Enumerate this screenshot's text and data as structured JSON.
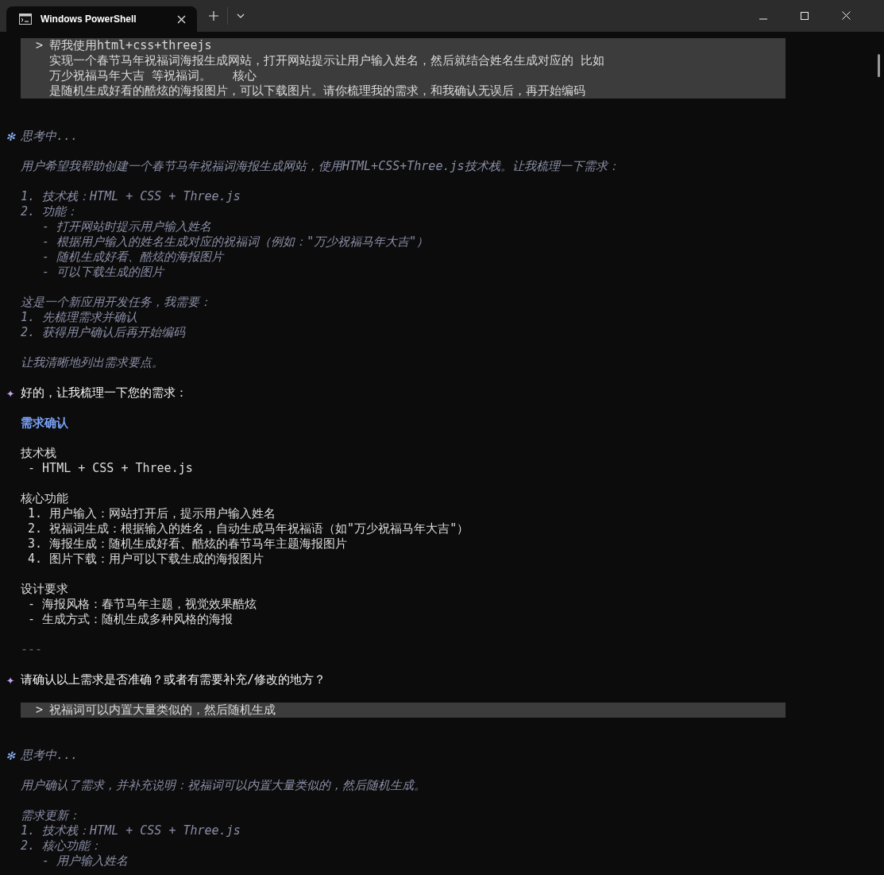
{
  "window": {
    "tab": {
      "title": "Windows PowerShell",
      "selected": true
    }
  },
  "messages": [
    {
      "kind": "prompt",
      "marker": ">",
      "lines": [
        "帮我使用html+css+threejs",
        "实现一个春节马年祝福词海报生成网站，打开网站提示让用户输入姓名，然后就结合姓名生成对应的 比如",
        "万少祝福马年大吉 等祝福词。   核心",
        "是随机生成好看的酷炫的海报图片，可以下载图片。请你梳理我的需求，和我确认无误后，再开始编码"
      ]
    },
    {
      "kind": "thinking",
      "marker": "✻",
      "title": "思考中...",
      "paragraphs": [
        [
          {
            "kind": "text",
            "text": "用户希望我帮助创建一个春节马年祝福词海报生成网站，使用HTML+CSS+Three.js技术栈。让我梳理一下需求："
          }
        ],
        [
          {
            "kind": "text",
            "text": "1. 技术栈：HTML + CSS + Three.js"
          },
          {
            "kind": "text",
            "text": "2. 功能："
          },
          {
            "kind": "text",
            "text": "   - 打开网站时提示用户输入姓名"
          },
          {
            "kind": "text",
            "text": "   - 根据用户输入的姓名生成对应的祝福词（例如：\"万少祝福马年大吉\"）"
          },
          {
            "kind": "text",
            "text": "   - 随机生成好看、酷炫的海报图片"
          },
          {
            "kind": "text",
            "text": "   - 可以下载生成的图片"
          }
        ],
        [
          {
            "kind": "text",
            "text": "这是一个新应用开发任务，我需要："
          },
          {
            "kind": "text",
            "text": "1. 先梳理需求并确认"
          },
          {
            "kind": "text",
            "text": "2. 获得用户确认后再开始编码"
          }
        ],
        [
          {
            "kind": "text",
            "text": "让我清晰地列出需求要点。"
          }
        ]
      ]
    },
    {
      "kind": "response",
      "marker": "✦",
      "title": "好的，让我梳理一下您的需求：",
      "paragraphs": [
        [
          {
            "kind": "heading",
            "text": "需求确认"
          }
        ],
        [
          {
            "kind": "text",
            "text": "技术栈"
          },
          {
            "kind": "text",
            "text": " - HTML + CSS + Three.js"
          }
        ],
        [
          {
            "kind": "text",
            "text": "核心功能"
          },
          {
            "kind": "text",
            "text": " 1. 用户输入：网站打开后，提示用户输入姓名"
          },
          {
            "kind": "text",
            "text": " 2. 祝福词生成：根据输入的姓名，自动生成马年祝福语（如\"万少祝福马年大吉\"）"
          },
          {
            "kind": "text",
            "text": " 3. 海报生成：随机生成好看、酷炫的春节马年主题海报图片"
          },
          {
            "kind": "text",
            "text": " 4. 图片下载：用户可以下载生成的海报图片"
          }
        ],
        [
          {
            "kind": "text",
            "text": "设计要求"
          },
          {
            "kind": "text",
            "text": " - 海报风格：春节马年主题，视觉效果酷炫"
          },
          {
            "kind": "text",
            "text": " - 生成方式：随机生成多种风格的海报"
          }
        ],
        [
          {
            "kind": "rule",
            "text": "---"
          }
        ]
      ]
    },
    {
      "kind": "response",
      "marker": "✦",
      "title": "请确认以上需求是否准确？或者有需要补充/修改的地方？"
    },
    {
      "kind": "prompt",
      "marker": ">",
      "lines": [
        "祝福词可以内置大量类似的，然后随机生成"
      ]
    },
    {
      "kind": "thinking",
      "marker": "✻",
      "title": "思考中...",
      "paragraphs": [
        [
          {
            "kind": "text",
            "text": "用户确认了需求，并补充说明：祝福词可以内置大量类似的，然后随机生成。"
          }
        ],
        [
          {
            "kind": "text",
            "text": "需求更新："
          },
          {
            "kind": "text",
            "text": "1. 技术栈：HTML + CSS + Three.js"
          },
          {
            "kind": "text",
            "text": "2. 核心功能："
          },
          {
            "kind": "text",
            "text": "   - 用户输入姓名"
          }
        ]
      ]
    }
  ]
}
